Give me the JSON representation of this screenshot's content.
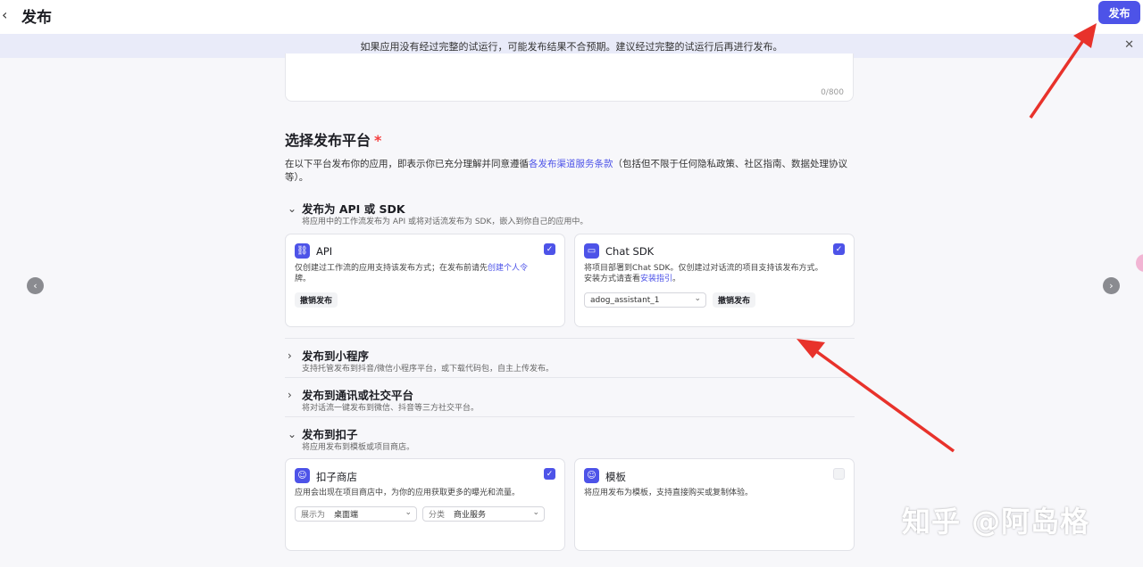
{
  "header": {
    "back_icon": "chevron-left-icon",
    "title": "发布",
    "publish_label": "发布"
  },
  "banner": {
    "text": "如果应用没有经过完整的试运行，可能发布结果不合预期。建议经过完整的试运行后再进行发布。",
    "close_icon": "close-icon"
  },
  "description_box": {
    "char_count": "0/800"
  },
  "platform_section": {
    "title": "选择发布平台",
    "required_mark": "*",
    "desc_before": "在以下平台发布你的应用，即表示你已充分理解并同意遵循",
    "desc_link": "各发布渠道服务条款",
    "desc_after": "（包括但不限于任何隐私政策、社区指南、数据处理协议等）。"
  },
  "groups": {
    "api_sdk": {
      "title": "发布为 API 或 SDK",
      "subtitle": "将应用中的工作流发布为 API 或将对话流发布为 SDK，嵌入到你自己的应用中。",
      "expanded": true,
      "cards": {
        "api": {
          "title": "API",
          "checked": true,
          "desc_before": "仅创建过工作流的应用支持该发布方式；在发布前请先",
          "desc_link": "创建个人令",
          "desc_after": "牌。",
          "revoke_label": "撤销发布"
        },
        "chat_sdk": {
          "title": "Chat SDK",
          "checked": true,
          "desc_line1": "将项目部署到Chat SDK。仅创建过对话流的项目支持该发布方式。",
          "desc_line2_before": "安装方式请查看",
          "desc_line2_link": "安装指引",
          "desc_line2_after": "。",
          "select_value": "adog_assistant_1",
          "revoke_label": "撤销发布"
        }
      }
    },
    "mini_program": {
      "title": "发布到小程序",
      "subtitle": "支持托管发布到抖音/微信小程序平台，或下载代码包，自主上传发布。",
      "expanded": false
    },
    "social": {
      "title": "发布到通讯或社交平台",
      "subtitle": "将对话流一键发布到微信、抖音等三方社交平台。",
      "expanded": false
    },
    "kouzi": {
      "title": "发布到扣子",
      "subtitle": "将应用发布到模板或项目商店。",
      "expanded": true,
      "cards": {
        "store": {
          "title": "扣子商店",
          "checked": true,
          "desc": "应用会出现在项目商店中，为你的应用获取更多的曝光和流量。",
          "display_label": "展示为",
          "display_value": "桌面端",
          "category_label": "分类",
          "category_value": "商业服务"
        },
        "template": {
          "title": "模板",
          "checked": false,
          "desc": "将应用发布为模板，支持直接购买或复制体验。"
        }
      }
    }
  },
  "watermark": "知乎 @阿岛格",
  "colors": {
    "accent": "#4d53e8",
    "banner_bg": "#e9ebf9",
    "arrow": "#e8322b"
  }
}
